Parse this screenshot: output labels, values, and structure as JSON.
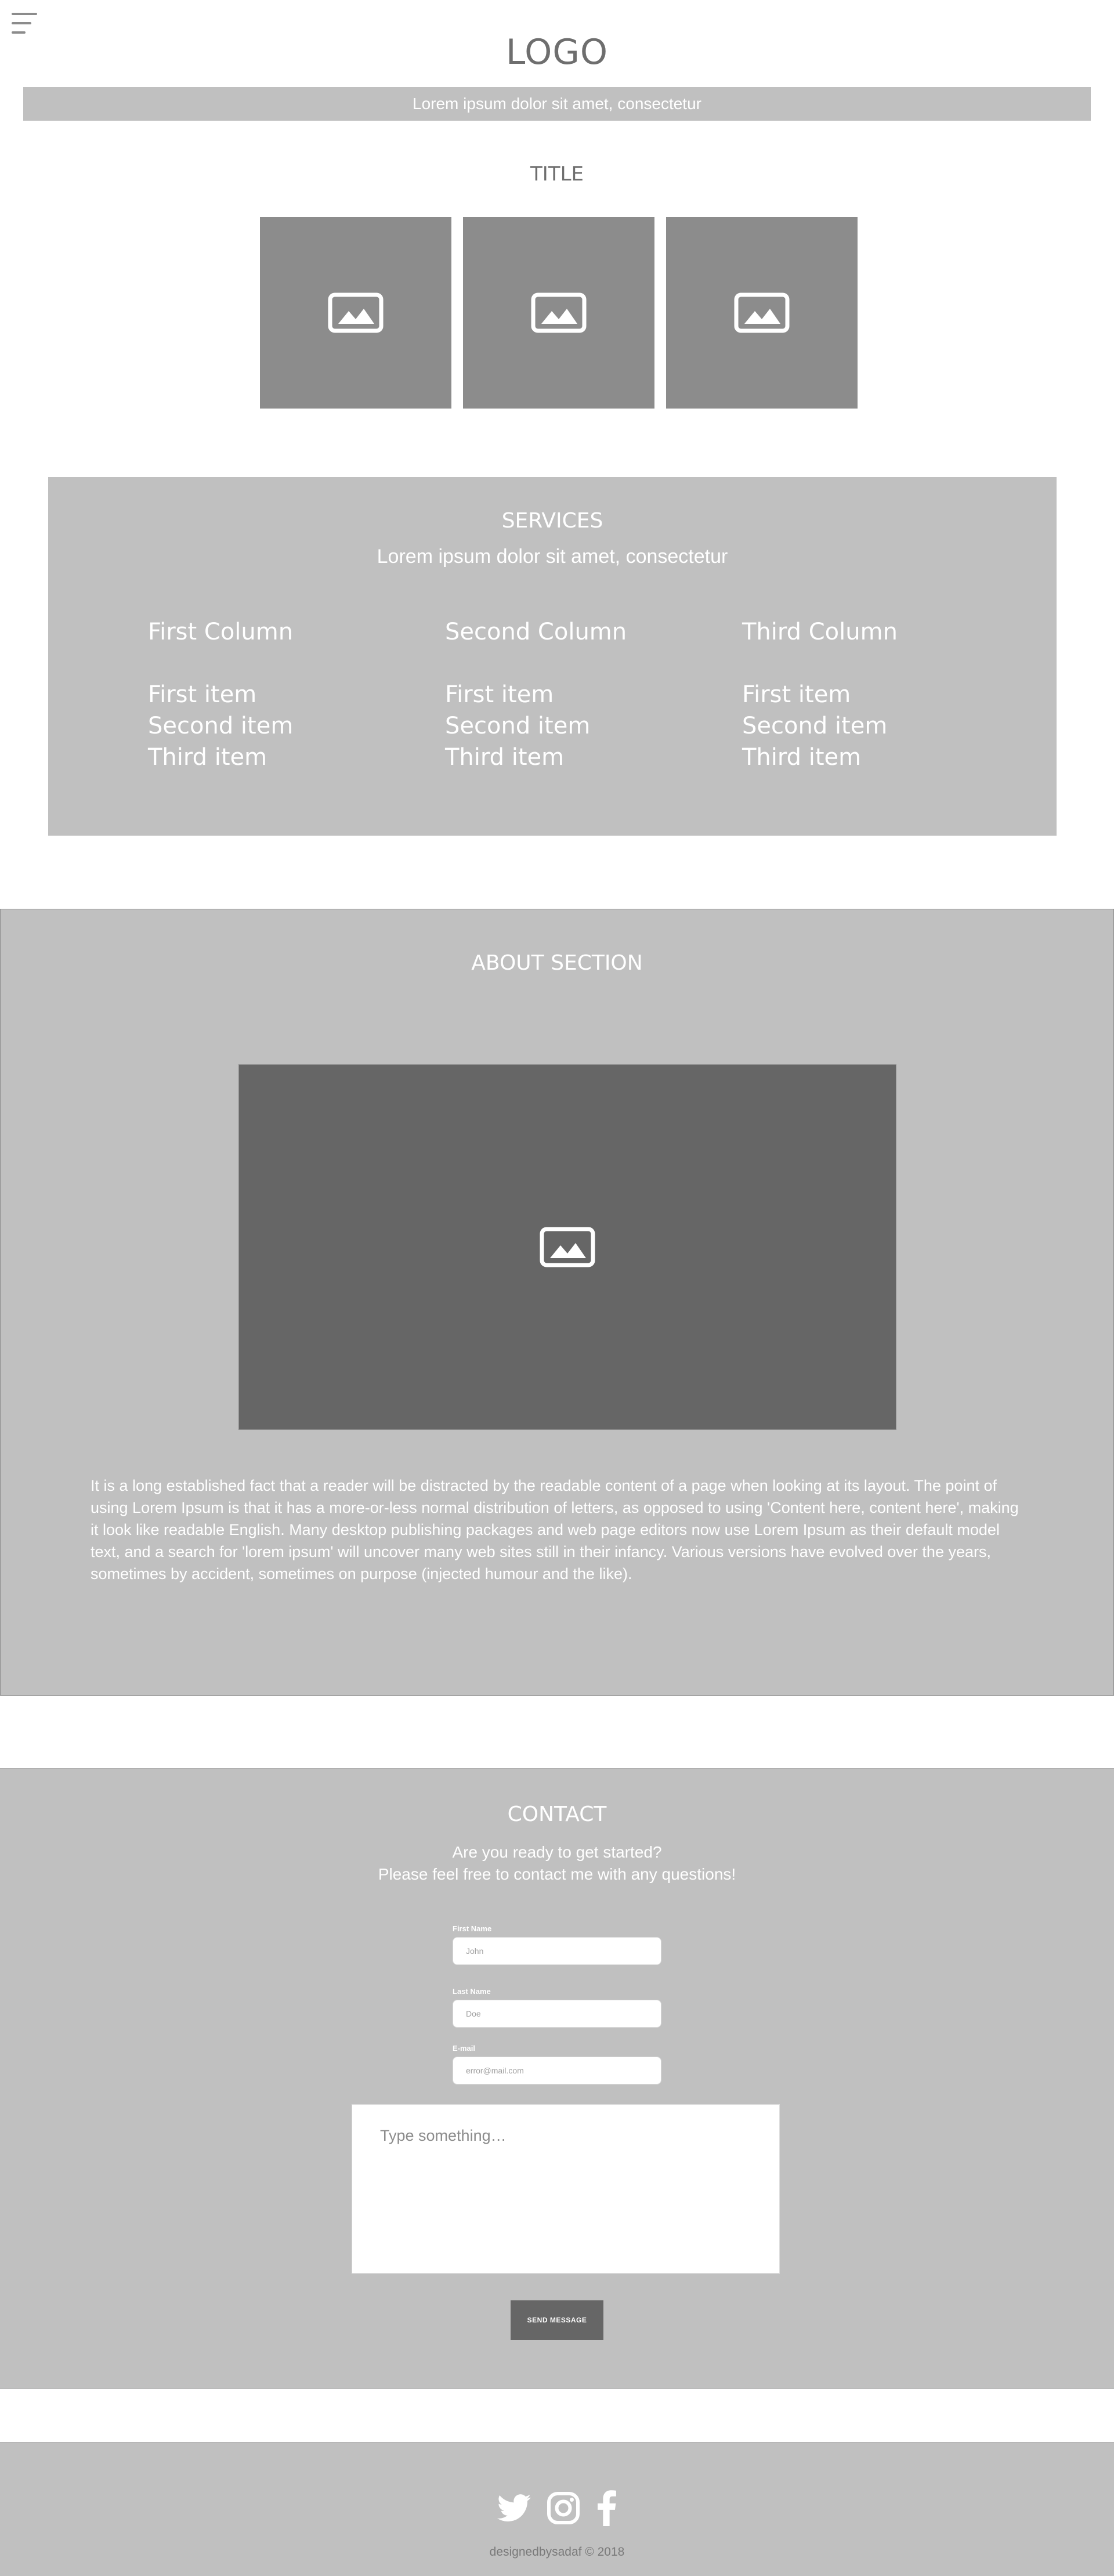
{
  "header": {
    "logo": "LOGO",
    "banner_text": "Lorem ipsum dolor sit amet, consectetur",
    "menu_icon": "hamburger-icon"
  },
  "gallery": {
    "title": "TITLE",
    "icon": "image-placeholder-icon"
  },
  "services": {
    "title": "SERVICES",
    "subtitle": "Lorem ipsum dolor sit amet, consectetur",
    "columns": [
      {
        "heading": "First Column",
        "items": [
          "First item",
          "Second item",
          "Third item"
        ]
      },
      {
        "heading": "Second Column",
        "items": [
          "First item",
          "Second item",
          "Third item"
        ]
      },
      {
        "heading": "Third Column",
        "items": [
          "First item",
          "Second item",
          "Third item"
        ]
      }
    ]
  },
  "about": {
    "title": "ABOUT SECTION",
    "body": "It is a long established fact that a reader will be distracted by the readable content of a page when looking at its layout. The point of using Lorem Ipsum is that it has a more-or-less normal distribution of letters, as opposed to using 'Content here, content here', making it look like readable English. Many desktop publishing packages and web page editors now use Lorem Ipsum as their default model text, and a search for 'lorem ipsum' will uncover many web sites still in their infancy. Various versions have evolved over the years, sometimes by accident, sometimes on purpose (injected humour and the like)."
  },
  "contact": {
    "title": "CONTACT",
    "line1": "Are you ready to get started?",
    "line2": "Please feel free to contact me with any questions!",
    "first_name_label": "First Name",
    "first_name_placeholder": "John",
    "last_name_label": "Last Name",
    "last_name_placeholder": "Doe",
    "email_label": "E-mail",
    "email_placeholder": "error@mail.com",
    "message_placeholder": "Type something…",
    "send_label": "SEND MESSAGE"
  },
  "footer": {
    "social_icons": [
      "twitter-icon",
      "instagram-icon",
      "facebook-icon"
    ],
    "copyright": "designedbysadaf © 2018"
  },
  "colors": {
    "panel": "#c0c0c0",
    "dark": "#666666",
    "mid": "#8c8c8c",
    "text": "#ffffff",
    "logo": "#6e6e6e"
  }
}
